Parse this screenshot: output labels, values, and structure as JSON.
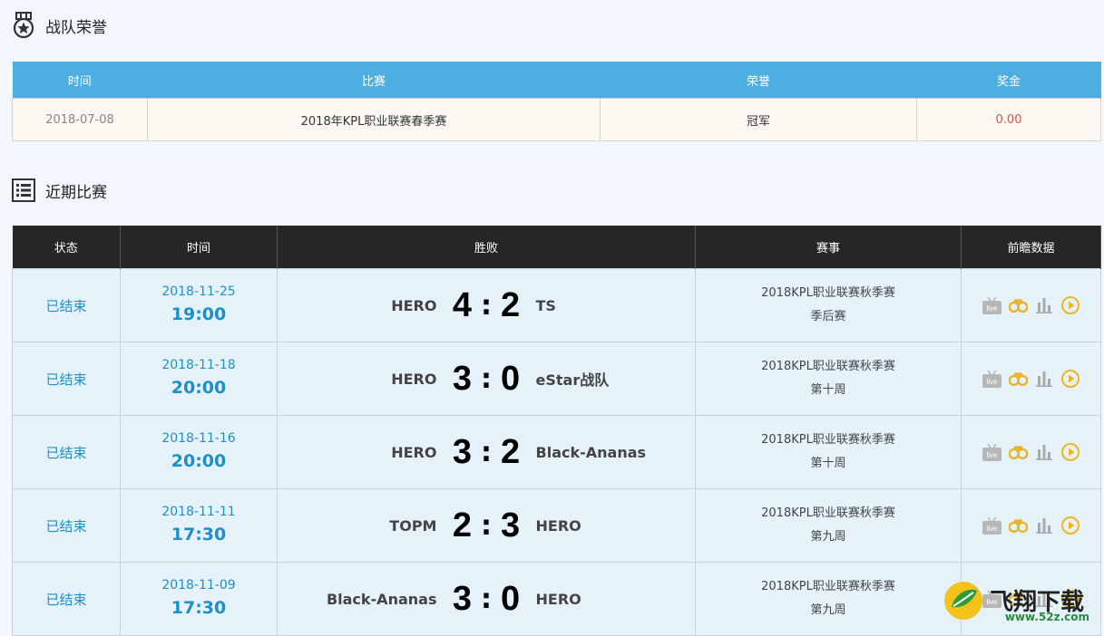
{
  "honor": {
    "title": "战队荣誉",
    "headers": [
      "时间",
      "比赛",
      "荣誉",
      "奖金"
    ],
    "rows": [
      {
        "date": "2018-07-08",
        "match": "2018年KPL职业联赛春季赛",
        "honor": "冠军",
        "prize": "0.00"
      }
    ]
  },
  "recent": {
    "title": "近期比赛",
    "headers": [
      "状态",
      "时间",
      "胜败",
      "赛事",
      "前瞻数据"
    ],
    "rows": [
      {
        "status": "已结束",
        "date": "2018-11-25",
        "time": "19:00",
        "team_left": "HERO",
        "score_left": "4",
        "score_right": "2",
        "team_right": "TS",
        "event": "2018KPL职业联赛秋季赛",
        "stage": "季后赛"
      },
      {
        "status": "已结束",
        "date": "2018-11-18",
        "time": "20:00",
        "team_left": "HERO",
        "score_left": "3",
        "score_right": "0",
        "team_right": "eStar战队",
        "event": "2018KPL职业联赛秋季赛",
        "stage": "第十周"
      },
      {
        "status": "已结束",
        "date": "2018-11-16",
        "time": "20:00",
        "team_left": "HERO",
        "score_left": "3",
        "score_right": "2",
        "team_right": "Black-Ananas",
        "event": "2018KPL职业联赛秋季赛",
        "stage": "第十周"
      },
      {
        "status": "已结束",
        "date": "2018-11-11",
        "time": "17:30",
        "team_left": "TOPM",
        "score_left": "2",
        "score_right": "3",
        "team_right": "HERO",
        "event": "2018KPL职业联赛秋季赛",
        "stage": "第九周"
      },
      {
        "status": "已结束",
        "date": "2018-11-09",
        "time": "17:30",
        "team_left": "Black-Ananas",
        "score_left": "3",
        "score_right": "0",
        "team_right": "HERO",
        "event": "2018KPL职业联赛秋季赛",
        "stage": "第九周"
      }
    ],
    "tool_icons": [
      "live-icon",
      "binoculars-icon",
      "bar-chart-icon",
      "play-icon"
    ],
    "tool_colors": {
      "live": "#b7b7b7",
      "binoculars": "#e8b530",
      "chart": "#aaaaaa",
      "play": "#f0b521"
    }
  },
  "watermark": {
    "text": "飞翔下载",
    "url": "www.52z.com"
  }
}
